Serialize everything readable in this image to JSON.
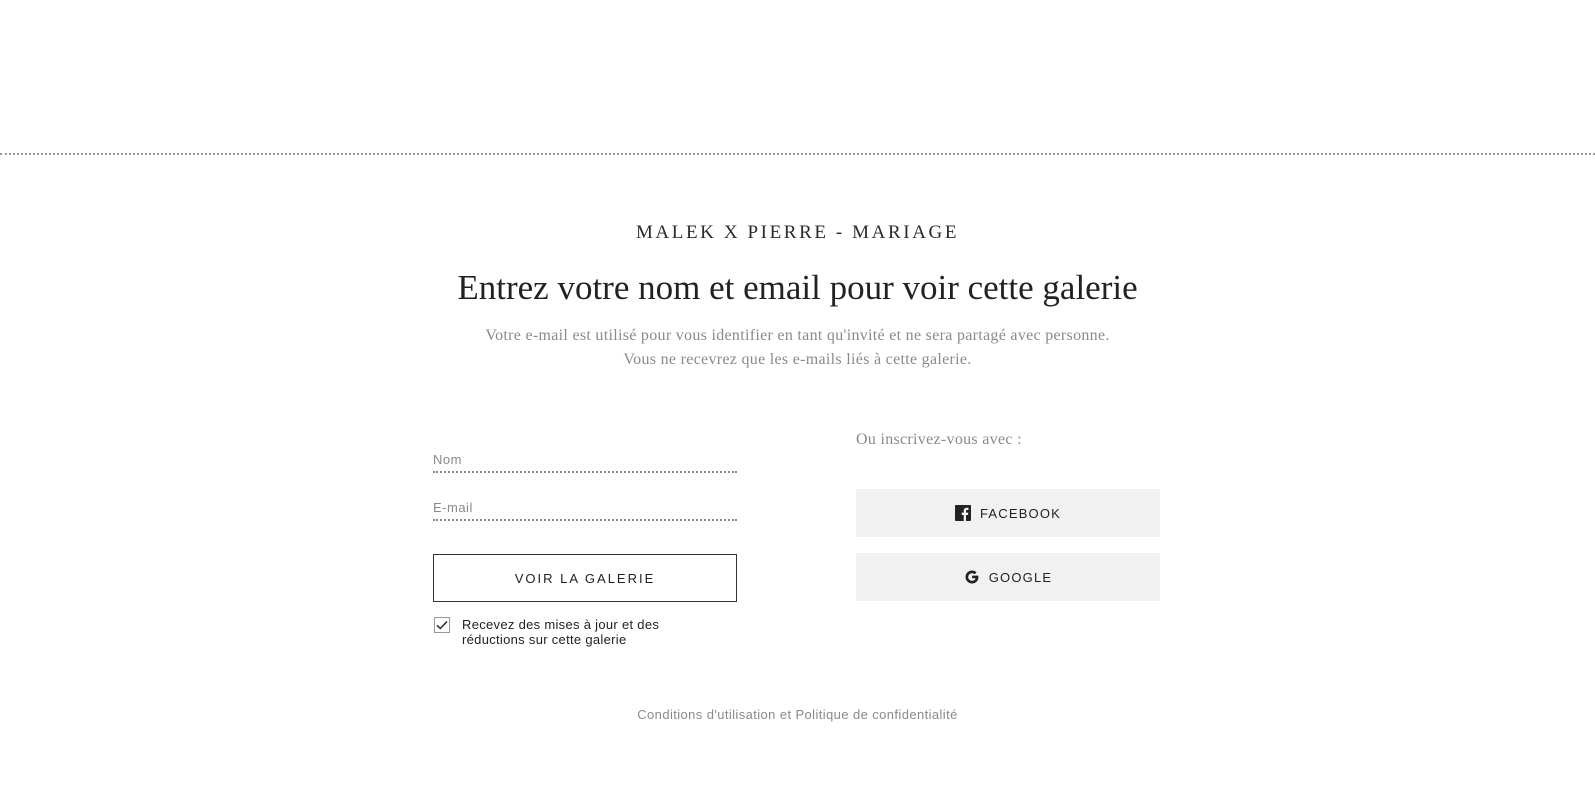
{
  "gallery": {
    "title": "MALEK X PIERRE - MARIAGE"
  },
  "headline": "Entrez votre nom et email pour voir cette galerie",
  "subtitle": {
    "line1": "Votre e-mail est utilisé pour vous identifier en tant qu'invité et ne sera partagé avec personne.",
    "line2": "Vous ne recevrez que les e-mails liés à cette galerie."
  },
  "form": {
    "name_placeholder": "Nom",
    "email_placeholder": "E-mail",
    "submit_label": "VOIR LA GALERIE",
    "optin_label": "Recevez des mises à jour et des réductions sur cette galerie",
    "optin_checked": true
  },
  "social": {
    "label": "Ou inscrivez-vous avec :",
    "facebook_label": "FACEBOOK",
    "facebook_icon": "facebook-icon",
    "google_label": "GOOGLE",
    "google_icon": "google-icon"
  },
  "footer": {
    "terms_label": "Conditions d'utilisation et Politique de confidentialité"
  },
  "colors": {
    "text_dark": "#222222",
    "text_muted": "#8a8a8a",
    "social_button_bg": "#f1f1f1",
    "button_border": "#333333"
  }
}
